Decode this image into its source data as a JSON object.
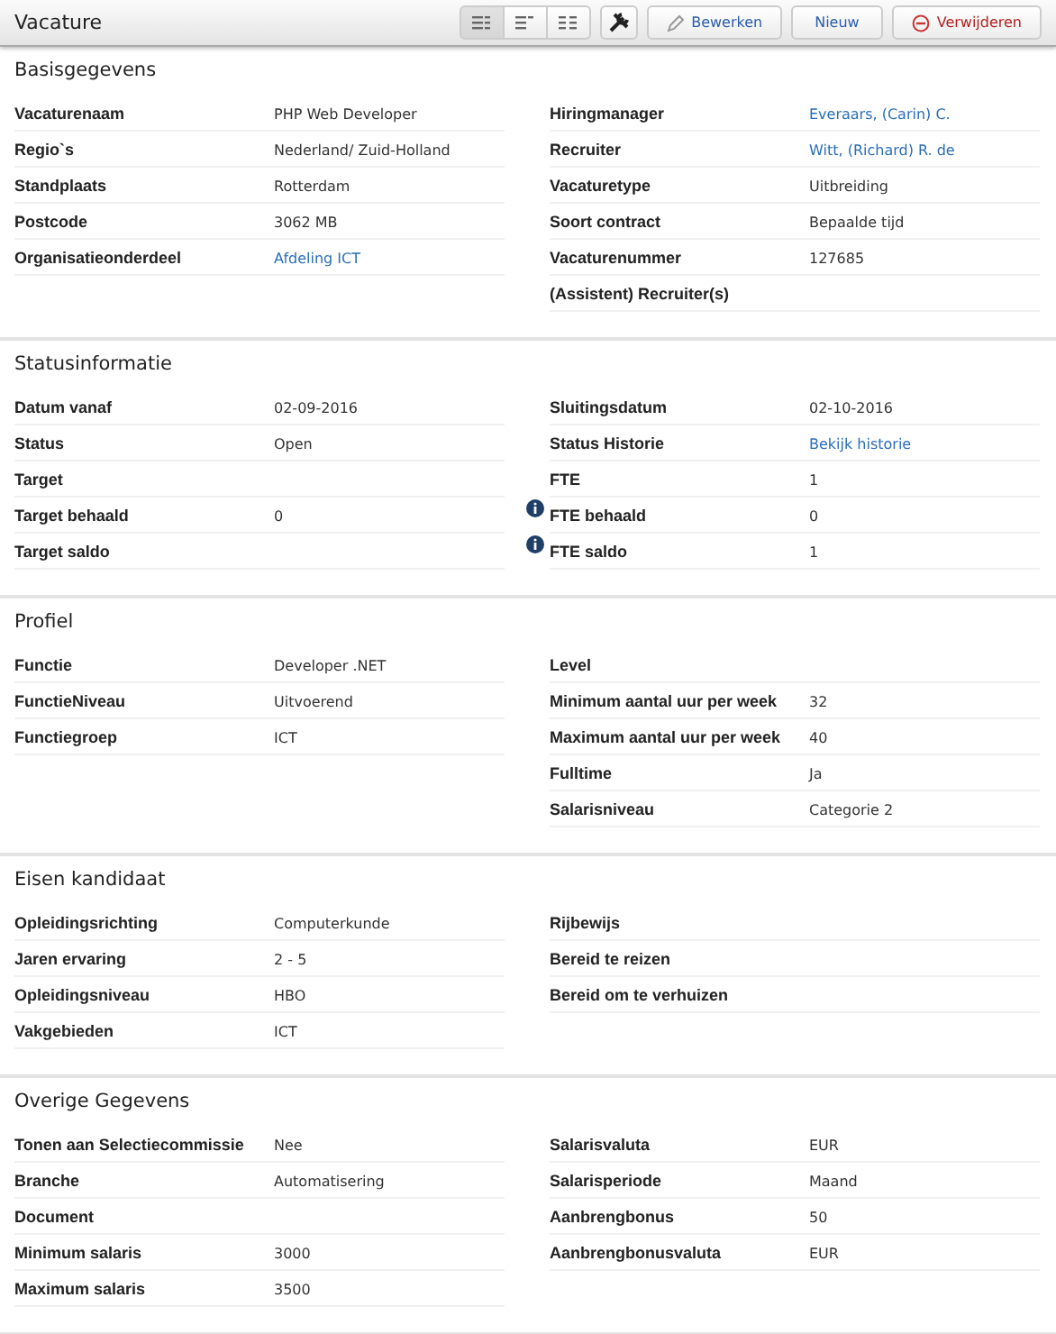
{
  "header": {
    "title": "Vacature",
    "view_modes": [
      {
        "selected": true
      },
      {
        "selected": false
      },
      {
        "selected": false
      }
    ],
    "buttons": [
      {
        "kind": "tools"
      },
      {
        "kind": "edit",
        "label": "Bewerken"
      },
      {
        "kind": "plain",
        "label": "Nieuw"
      },
      {
        "kind": "delete",
        "label": "Verwijderen"
      }
    ]
  },
  "sections": [
    {
      "title": "Basisgegevens",
      "left": [
        {
          "label": "Vacaturenaam",
          "value": "PHP Web Developer"
        },
        {
          "label": "Regio`s",
          "value": "Nederland/ Zuid-Holland"
        },
        {
          "label": "Standplaats",
          "value": "Rotterdam"
        },
        {
          "label": "Postcode",
          "value": "3062 MB"
        },
        {
          "label": "Organisatieonderdeel",
          "value": "Afdeling ICT",
          "link": true
        }
      ],
      "right": [
        {
          "label": "Hiringmanager",
          "value": "Everaars, (Carin) C.",
          "link": true
        },
        {
          "label": "Recruiter",
          "value": "Witt, (Richard) R. de",
          "link": true
        },
        {
          "label": "Vacaturetype",
          "value": "Uitbreiding"
        },
        {
          "label": "Soort contract",
          "value": "Bepaalde tijd"
        },
        {
          "label": "Vacaturenummer",
          "value": "127685"
        },
        {
          "label": "(Assistent) Recruiter(s)"
        }
      ]
    },
    {
      "title": "Statusinformatie",
      "left": [
        {
          "label": "Datum vanaf",
          "value": "02-09-2016"
        },
        {
          "label": "Status",
          "value": "Open"
        },
        {
          "label": "Target"
        },
        {
          "label": "Target behaald",
          "value": "0"
        },
        {
          "label": "Target saldo"
        }
      ],
      "right": [
        {
          "label": "Sluitingsdatum",
          "value": "02-10-2016"
        },
        {
          "label": "Status Historie",
          "value": "Bekijk historie",
          "link": true
        },
        {
          "label": "FTE",
          "value": "1"
        },
        {
          "label": "FTE behaald",
          "value": "0",
          "info": true
        },
        {
          "label": "FTE saldo",
          "value": "1",
          "info": true
        }
      ]
    },
    {
      "title": "Profiel",
      "left": [
        {
          "label": "Functie",
          "value": "Developer .NET"
        },
        {
          "label": "FunctieNiveau",
          "value": "Uitvoerend"
        },
        {
          "label": "Functiegroep",
          "value": "ICT"
        }
      ],
      "right": [
        {
          "label": "Level"
        },
        {
          "label": "Minimum aantal uur per week",
          "value": "32"
        },
        {
          "label": "Maximum aantal uur per week",
          "value": "40"
        },
        {
          "label": "Fulltime",
          "value": "Ja"
        },
        {
          "label": "Salarisniveau",
          "value": "Categorie 2"
        }
      ]
    },
    {
      "title": "Eisen kandidaat",
      "left": [
        {
          "label": "Opleidingsrichting",
          "value": "Computerkunde"
        },
        {
          "label": "Jaren ervaring",
          "value": "2 - 5"
        },
        {
          "label": "Opleidingsniveau",
          "value": "HBO"
        },
        {
          "label": "Vakgebieden",
          "value": "ICT"
        }
      ],
      "right": [
        {
          "label": "Rijbewijs"
        },
        {
          "label": "Bereid te reizen"
        },
        {
          "label": "Bereid om te verhuizen"
        }
      ]
    },
    {
      "title": "Overige Gegevens",
      "left": [
        {
          "label": "Tonen aan Selectiecommissie",
          "value": "Nee"
        },
        {
          "label": "Branche",
          "value": "Automatisering"
        },
        {
          "label": "Document"
        },
        {
          "label": "Minimum salaris",
          "value": "3000"
        },
        {
          "label": "Maximum salaris",
          "value": "3500"
        }
      ],
      "right": [
        {
          "label": "Salarisvaluta",
          "value": "EUR"
        },
        {
          "label": "Salarisperiode",
          "value": "Maand"
        },
        {
          "label": "Aanbrengbonus",
          "value": "50"
        },
        {
          "label": "Aanbrengbonusvaluta",
          "value": "EUR"
        }
      ]
    }
  ]
}
